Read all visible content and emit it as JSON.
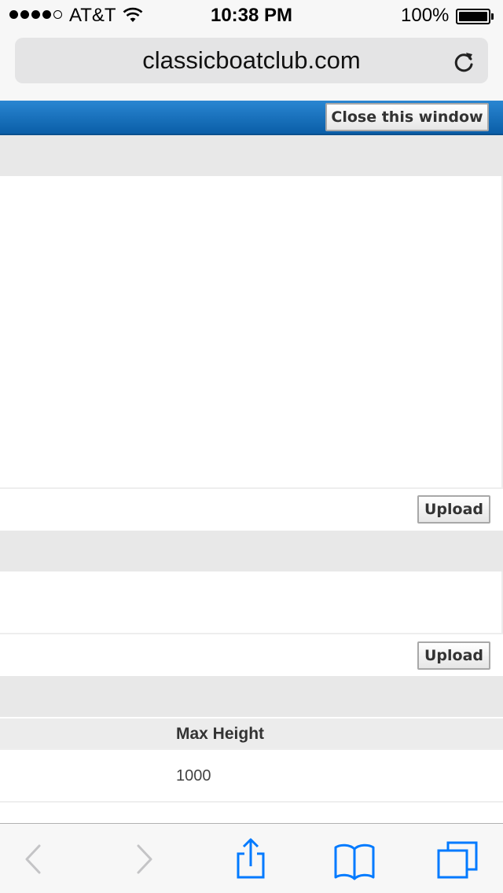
{
  "status_bar": {
    "carrier": "AT&T",
    "time": "10:38 PM",
    "battery_percent": "100%",
    "signal_bars_filled": 4,
    "signal_bars_total": 5,
    "icons": [
      "signal-dots-icon",
      "wifi-icon",
      "battery-icon"
    ]
  },
  "browser": {
    "url": "classicboatclub.com",
    "icons": [
      "reload-icon"
    ]
  },
  "page": {
    "close_button_label": "Close this window",
    "upload_button_1_label": "Upload",
    "upload_button_2_label": "Upload",
    "table": {
      "column_header": "Max Height",
      "cell_value": "1000"
    }
  },
  "toolbar": {
    "icons": [
      "back-icon",
      "forward-icon",
      "share-icon",
      "bookmarks-icon",
      "tabs-icon"
    ]
  },
  "colors": {
    "accent": "#007aff",
    "header_blue": "#0a6cbf",
    "band_gray": "#e8e8e8"
  }
}
